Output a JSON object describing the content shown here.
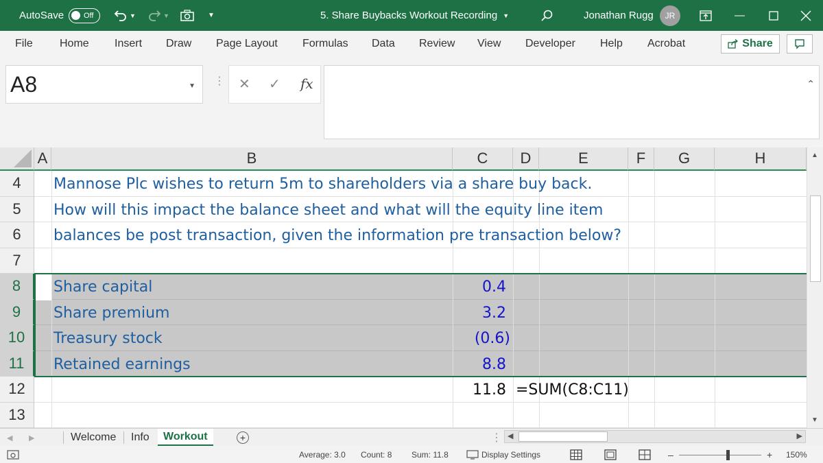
{
  "titlebar": {
    "autosave_label": "AutoSave",
    "autosave_state": "Off",
    "document_title": "5. Share Buybacks Workout Recording",
    "user_name": "Jonathan Rugg",
    "user_initials": "JR"
  },
  "ribbon": {
    "tabs": [
      "File",
      "Home",
      "Insert",
      "Draw",
      "Page Layout",
      "Formulas",
      "Data",
      "Review",
      "View",
      "Developer",
      "Help",
      "Acrobat"
    ],
    "share_label": "Share"
  },
  "formula_bar": {
    "name_box": "A8",
    "fx_label": "fx",
    "content": ""
  },
  "grid": {
    "columns": [
      "A",
      "B",
      "C",
      "D",
      "E",
      "F",
      "G",
      "H"
    ],
    "rows": [
      "4",
      "5",
      "6",
      "7",
      "8",
      "9",
      "10",
      "11",
      "12",
      "13"
    ],
    "text_lines": [
      "Mannose Plc wishes to return 5m to shareholders via a share buy back.",
      "How will this impact the balance sheet and what will the equity line item",
      "balances be post transaction, given the information pre transaction below?"
    ],
    "items": [
      {
        "label": "Share capital",
        "value": "0.4"
      },
      {
        "label": "Share premium",
        "value": "3.2"
      },
      {
        "label": "Treasury stock",
        "value": "(0.6)"
      },
      {
        "label": "Retained earnings",
        "value": "8.8"
      }
    ],
    "total_value": "11.8",
    "total_formula": "=SUM(C8:C11)"
  },
  "sheets": {
    "tabs": [
      "Welcome",
      "Info",
      "Workout"
    ],
    "active": "Workout"
  },
  "statusbar": {
    "average": "Average: 3.0",
    "count": "Count: 8",
    "sum": "Sum: 11.8",
    "display_settings": "Display Settings",
    "zoom": "150%"
  }
}
